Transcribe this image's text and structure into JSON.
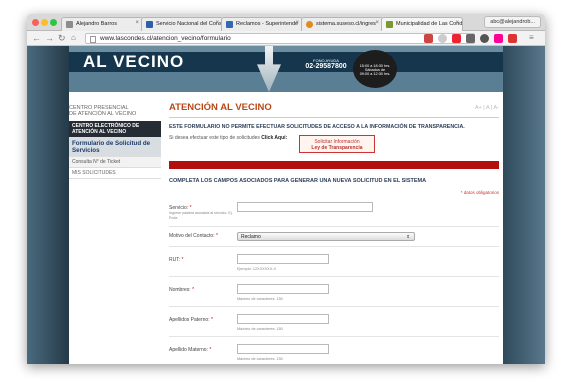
{
  "browser": {
    "tabs": [
      {
        "label": "Alejandro Barros",
        "favicon_color": "#8c8c8c"
      },
      {
        "label": "Servicio Nacional del Cons",
        "favicon_color": "#2f5fa5"
      },
      {
        "label": "Reclamos - Superintende",
        "favicon_color": "#3468b0"
      },
      {
        "label": "sistema.suseso.cl/ingres",
        "favicon_color": "#e28a1c"
      },
      {
        "label": "Municipalidad de Las Cond",
        "favicon_color": "#7a9a2f"
      }
    ],
    "user": "abc@alejandrob...",
    "url": "www.lascondes.cl/atencion_vecino/formulario"
  },
  "banner": {
    "title": "AL VECINO",
    "fono_label": "FONO AYUDA",
    "fono_number": "02-29587800",
    "badge_line1": "15:00 a 18:30 hrs.",
    "badge_line2": "Sábados de",
    "badge_line3": "09:00 a 12:30 hrs."
  },
  "sidebar": {
    "heading_line1": "CENTRO PRESENCIAL",
    "heading_line2": "DE ATENCIÓN AL VECINO",
    "items": [
      {
        "label": "CENTRO ELECTRÓNICO DE ATENCIÓN AL VECINO"
      },
      {
        "label": "Formulario de Solicitud de Servicios"
      },
      {
        "label": "Consulta N° de Ticket"
      },
      {
        "label": "MIS SOLICITUDES"
      }
    ]
  },
  "main": {
    "title": "ATENCIÓN AL VECINO",
    "font_controls": "A+ | A | A-",
    "warning": "ESTE FORMULARIO NO PERMITE EFECTUAR SOLICITUDES DE ACCESO A LA INFORMACIÓN DE TRANSPARENCIA.",
    "click_text": "Si desea efectuar este tipo de solicitudes",
    "click_bold": "Click Aquí:",
    "transparency_button_line1": "Solicitar Información",
    "transparency_button_line2": "Ley de Transparencia",
    "complete_heading": "COMPLETA LOS CAMPOS ASOCIADOS PARA GENERAR UNA NUEVA SOLICITUD EN EL SISTEMA",
    "required_note": "* datos obligatorios"
  },
  "form": {
    "servicio": {
      "label": "Servicio:",
      "star": "*",
      "sub": "Ingrese palabra asociada al servicio. Ej. Poda",
      "value": ""
    },
    "motivo": {
      "label": "Motivo del Contacto:",
      "star": "*",
      "value": "Reclamo"
    },
    "rut": {
      "label": "RUT:",
      "star": "*",
      "hint": "Ejemplo: 12XXXXXX-X",
      "value": ""
    },
    "nombres": {
      "label": "Nombres:",
      "star": "*",
      "hint": "Máximo de caracteres: 150",
      "value": ""
    },
    "paterno": {
      "label": "Apellidos Paterno:",
      "star": "*",
      "hint": "Máximo de caracteres: 150",
      "value": ""
    },
    "materno": {
      "label": "Apellido Materno:",
      "star": "*",
      "hint": "Máximo de caracteres: 150",
      "value": ""
    }
  }
}
